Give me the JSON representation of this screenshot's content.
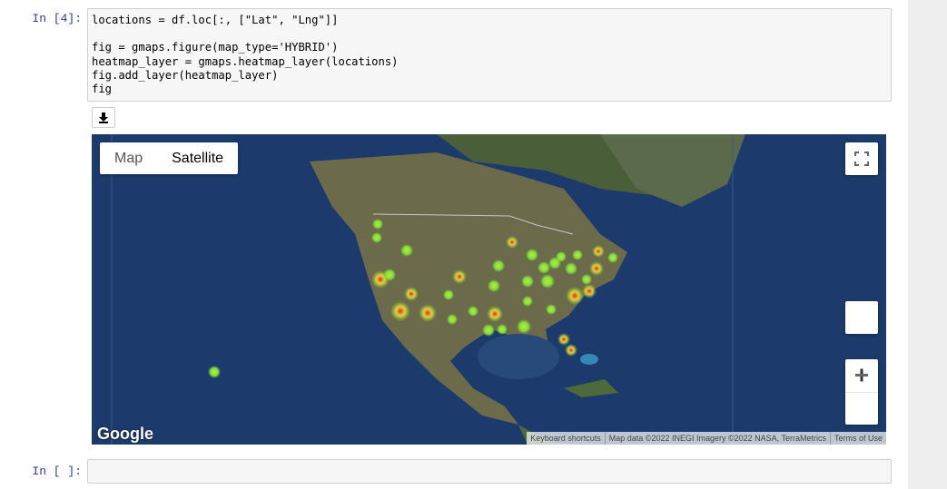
{
  "cells": [
    {
      "prompt": "In [4]:",
      "lines": [
        "locations = df.loc[:, [\"Lat\", \"Lng\"]]",
        "",
        "fig = gmaps.figure(map_type='HYBRID')",
        "heatmap_layer = gmaps.heatmap_layer(locations)",
        "fig.add_layer(heatmap_layer)",
        "fig"
      ]
    },
    {
      "prompt": "In [ ]:",
      "lines": [
        ""
      ]
    }
  ],
  "output": {
    "download_icon": "download-icon",
    "map_type": {
      "options": [
        "Map",
        "Satellite"
      ],
      "selected": "Satellite"
    },
    "fullscreen_icon": "fullscreen-icon",
    "zoom_in_icon": "plus-icon",
    "zoom_out_icon": "minus-icon",
    "pegman_icon": "street-view-icon",
    "google_logo": "Google",
    "attribution": [
      "Keyboard shortcuts",
      "Map data ©2022 INEGI Imagery ©2022 NASA, TerraMetrics",
      "Terms of Use"
    ]
  },
  "colors": {
    "prompt": "#303f9f",
    "ocean": "#1c3a6b",
    "land": "#6b6a4a",
    "heat_low": "#7ddf3a",
    "heat_mid": "#e8d13a",
    "heat_high": "#d8321f"
  }
}
